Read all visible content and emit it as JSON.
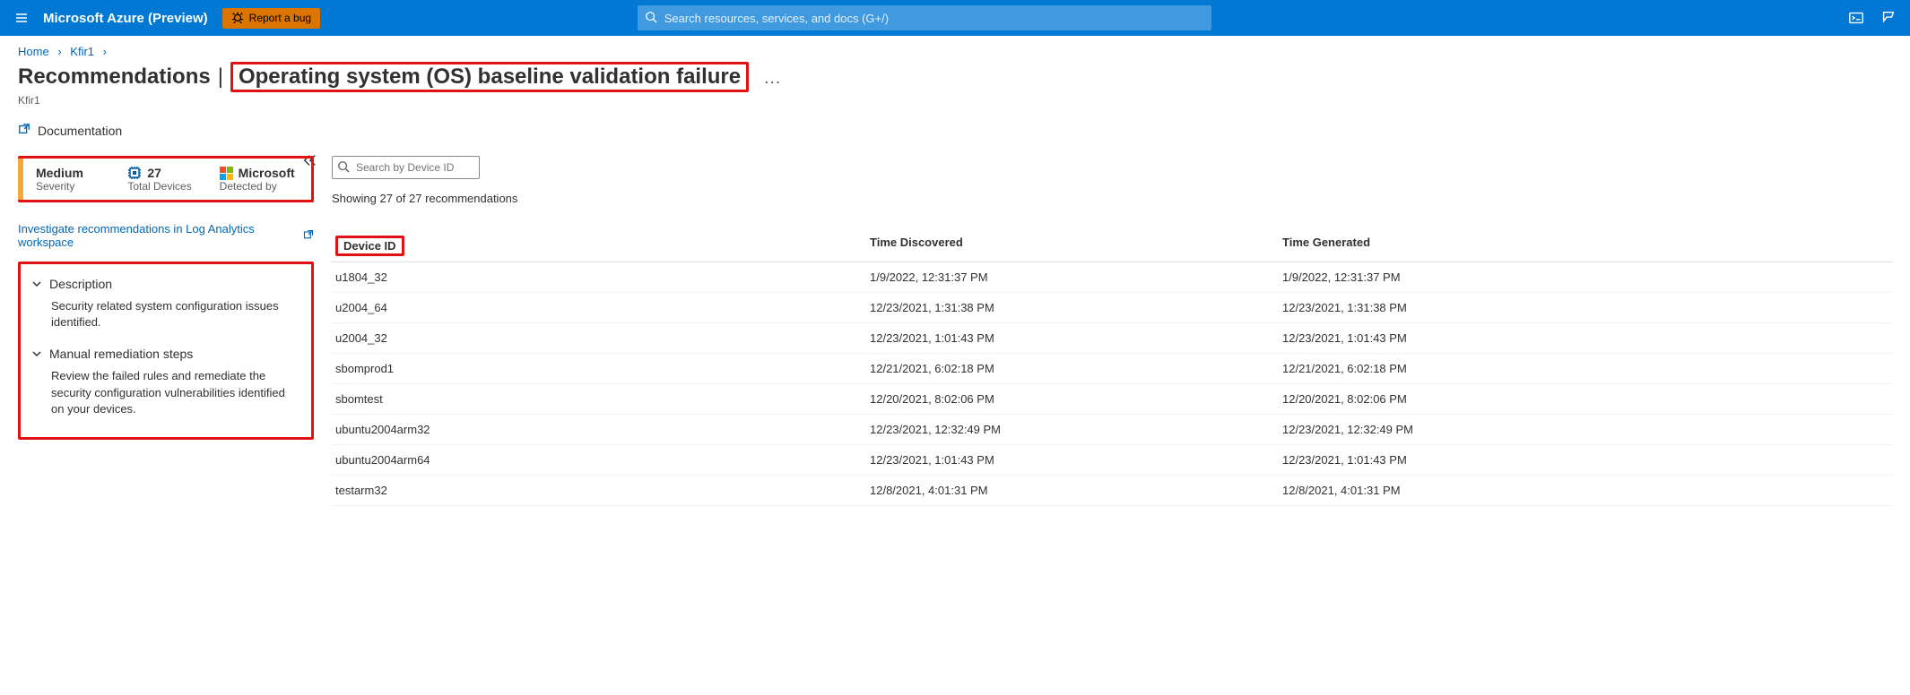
{
  "topbar": {
    "brand": "Microsoft Azure (Preview)",
    "bug_label": "Report a bug",
    "search_placeholder": "Search resources, services, and docs (G+/)"
  },
  "breadcrumb": {
    "home": "Home",
    "item1": "Kfir1"
  },
  "page": {
    "title_prefix": "Recommendations",
    "title_main": "Operating system (OS) baseline validation failure",
    "ellipsis": "…",
    "subtitle": "Kfir1",
    "doc_link": "Documentation"
  },
  "stats": {
    "severity_value": "Medium",
    "severity_label": "Severity",
    "devices_value": "27",
    "devices_label": "Total Devices",
    "detected_value": "Microsoft",
    "detected_label": "Detected by"
  },
  "investigate_link": "Investigate recommendations in Log Analytics workspace",
  "sections": {
    "description": {
      "title": "Description",
      "body": "Security related system configuration issues identified."
    },
    "remediation": {
      "title": "Manual remediation steps",
      "body": "Review the failed rules and remediate the security configuration vulnerabilities identified on your devices."
    }
  },
  "right": {
    "filter_placeholder": "Search by Device ID",
    "showing": "Showing 27 of 27 recommendations",
    "columns": {
      "device": "Device ID",
      "discovered": "Time Discovered",
      "generated": "Time Generated"
    },
    "rows": [
      {
        "device": "u1804_32",
        "discovered": "1/9/2022, 12:31:37 PM",
        "generated": "1/9/2022, 12:31:37 PM"
      },
      {
        "device": "u2004_64",
        "discovered": "12/23/2021, 1:31:38 PM",
        "generated": "12/23/2021, 1:31:38 PM"
      },
      {
        "device": "u2004_32",
        "discovered": "12/23/2021, 1:01:43 PM",
        "generated": "12/23/2021, 1:01:43 PM"
      },
      {
        "device": "sbomprod1",
        "discovered": "12/21/2021, 6:02:18 PM",
        "generated": "12/21/2021, 6:02:18 PM"
      },
      {
        "device": "sbomtest",
        "discovered": "12/20/2021, 8:02:06 PM",
        "generated": "12/20/2021, 8:02:06 PM"
      },
      {
        "device": "ubuntu2004arm32",
        "discovered": "12/23/2021, 12:32:49 PM",
        "generated": "12/23/2021, 12:32:49 PM"
      },
      {
        "device": "ubuntu2004arm64",
        "discovered": "12/23/2021, 1:01:43 PM",
        "generated": "12/23/2021, 1:01:43 PM"
      },
      {
        "device": "testarm32",
        "discovered": "12/8/2021, 4:01:31 PM",
        "generated": "12/8/2021, 4:01:31 PM"
      }
    ]
  }
}
